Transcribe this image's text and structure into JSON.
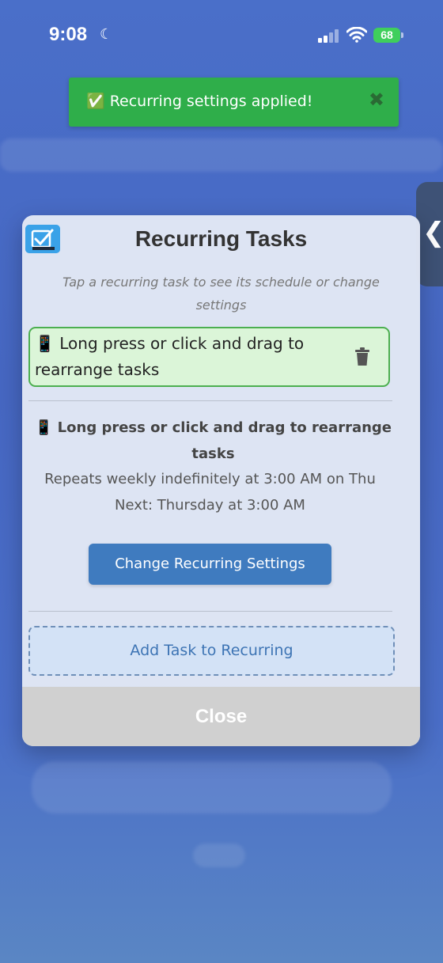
{
  "status_bar": {
    "time": "9:08",
    "battery": "68"
  },
  "toast": {
    "message": "✅ Recurring settings applied!",
    "close_label": "✖"
  },
  "side_handle": {
    "label": "❮"
  },
  "modal": {
    "title": "Recurring Tasks",
    "subtitle": "Tap a recurring task to see its schedule or change settings",
    "task": {
      "text": "📱 Long press or click and drag to rearrange tasks"
    },
    "detail": {
      "title": "📱 Long press or click and drag to rearrange tasks",
      "repeats": "Repeats weekly indefinitely at 3:00 AM on Thu",
      "next": "Next: Thursday at 3:00 AM"
    },
    "change_settings_label": "Change Recurring Settings",
    "add_task_label": "Add Task to Recurring",
    "close_label": "Close"
  },
  "colors": {
    "toast": "#2fae4a",
    "primary_button": "#3f7bbf",
    "task_card": "#dbf5d8",
    "task_border": "#4caf50"
  }
}
